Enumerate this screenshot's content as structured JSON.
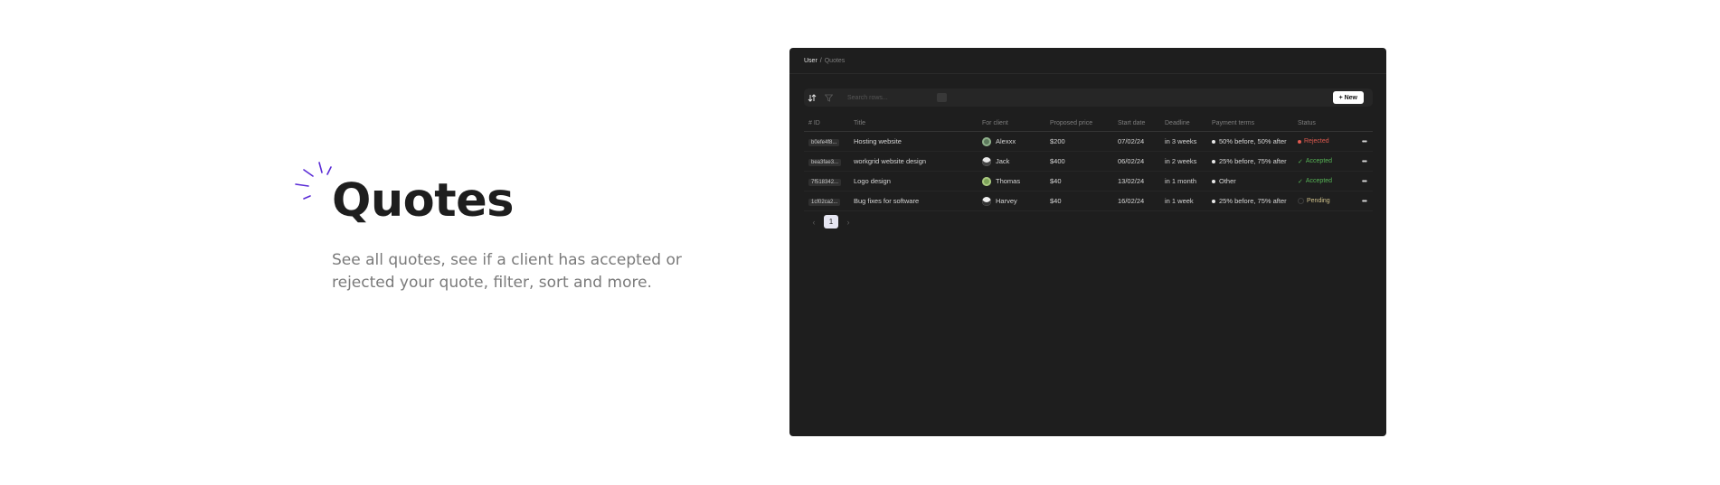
{
  "hero": {
    "title": "Quotes",
    "description": "See all quotes, see if a client has accepted or rejected your quote, filter, sort and more."
  },
  "app": {
    "breadcrumb": {
      "root": "User",
      "separator": "/",
      "current": "Quotes"
    },
    "toolbar": {
      "search_placeholder": "Search rows...",
      "new_button": "+ New"
    },
    "table": {
      "columns": [
        "# ID",
        "Title",
        "For client",
        "Proposed price",
        "Start date",
        "Deadline",
        "Payment terms",
        "Status"
      ],
      "rows": [
        {
          "id": "b0efe4f8...",
          "title": "Hosting website",
          "client": "Alexxx",
          "price": "$200",
          "start": "07/02/24",
          "deadline": "in 3 weeks",
          "terms": "50% before, 50% after",
          "status": "Rejected"
        },
        {
          "id": "bea3fae3...",
          "title": "workgrid website design",
          "client": "Jack",
          "price": "$400",
          "start": "06/02/24",
          "deadline": "in 2 weeks",
          "terms": "25% before, 75% after",
          "status": "Accepted"
        },
        {
          "id": "7f518342...",
          "title": "Logo design",
          "client": "Thomas",
          "price": "$40",
          "start": "13/02/24",
          "deadline": "in 1 month",
          "terms": "Other",
          "status": "Accepted"
        },
        {
          "id": "1cf02ca2...",
          "title": "Bug fixes for software",
          "client": "Harvey",
          "price": "$40",
          "start": "16/02/24",
          "deadline": "in 1 week",
          "terms": "25% before, 75% after",
          "status": "Pending"
        }
      ]
    },
    "pagination": {
      "current_page": "1"
    }
  },
  "colors": {
    "accent": "#5a2bd6",
    "window_bg": "#1e1e1e",
    "rejected": "#e05a50",
    "accepted": "#56b356",
    "deadline": "#5cae58"
  },
  "icons": [
    "sparkle-icon",
    "sort-icon",
    "filter-icon",
    "keyboard-shortcut-icon",
    "more-icon",
    "chevron-left-icon",
    "chevron-right-icon"
  ]
}
